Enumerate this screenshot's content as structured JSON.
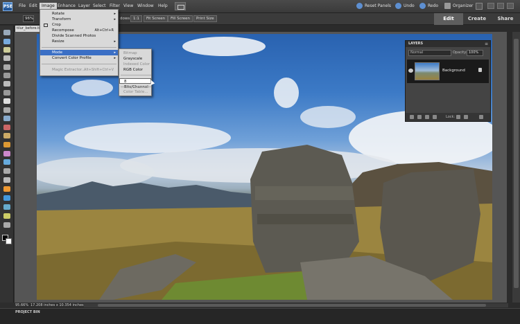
{
  "menubar": {
    "logo": "PSE",
    "items": [
      "File",
      "Edit",
      "Image",
      "Enhance",
      "Layer",
      "Select",
      "Filter",
      "View",
      "Window",
      "Help"
    ],
    "reset_panels": "Reset Panels",
    "undo": "Undo",
    "redo": "Redo",
    "organizer": "Organizer"
  },
  "options": {
    "zoom": "96%",
    "tag": "dows",
    "btn_1to1": "1:1",
    "btn_fit": "Fit Screen",
    "btn_fill": "Fill Screen",
    "btn_print": "Print Size"
  },
  "mode_tabs": [
    "Edit",
    "Create",
    "Share"
  ],
  "document": {
    "tab": "tilur_before.tif"
  },
  "status": {
    "zoom": "95.66%",
    "size": "17.208 inches x 10.354 inches"
  },
  "project_bin": "PROJECT BIN",
  "layers_panel": {
    "title": "LAYERS",
    "blend_mode": "Normal",
    "opacity_label": "Opacity:",
    "opacity_value": "100%",
    "layer_name": "Background",
    "lock_label": "Lock:"
  },
  "image_menu": {
    "items": [
      {
        "label": "Rotate",
        "shortcut": "",
        "submenu": true,
        "disabled": false
      },
      {
        "label": "Transform",
        "shortcut": "",
        "submenu": true,
        "disabled": false
      },
      {
        "label": "Crop",
        "shortcut": "",
        "submenu": false,
        "disabled": false
      },
      {
        "label": "Recompose",
        "shortcut": "Alt+Ctrl+R",
        "submenu": false,
        "disabled": false
      },
      {
        "label": "Divide Scanned Photos",
        "shortcut": "",
        "submenu": false,
        "disabled": false
      },
      {
        "label": "Resize",
        "shortcut": "",
        "submenu": true,
        "disabled": false
      },
      {
        "label": "Mode",
        "shortcut": "",
        "submenu": true,
        "disabled": false,
        "selected": true
      },
      {
        "label": "Convert Color Profile",
        "shortcut": "",
        "submenu": true,
        "disabled": false
      },
      {
        "label": "Magic Extractor...",
        "shortcut": "Alt+Shift+Ctrl+V",
        "submenu": false,
        "disabled": true
      }
    ]
  },
  "mode_menu": {
    "items": [
      {
        "label": "Bitmap",
        "disabled": true
      },
      {
        "label": "Grayscale",
        "disabled": false
      },
      {
        "label": "Indexed Color",
        "disabled": true
      },
      {
        "label": "RGB Color",
        "disabled": false
      },
      {
        "label": "8 Bits/Channel",
        "disabled": false,
        "highlighted": true
      },
      {
        "label": "Color Table...",
        "disabled": true
      }
    ]
  }
}
